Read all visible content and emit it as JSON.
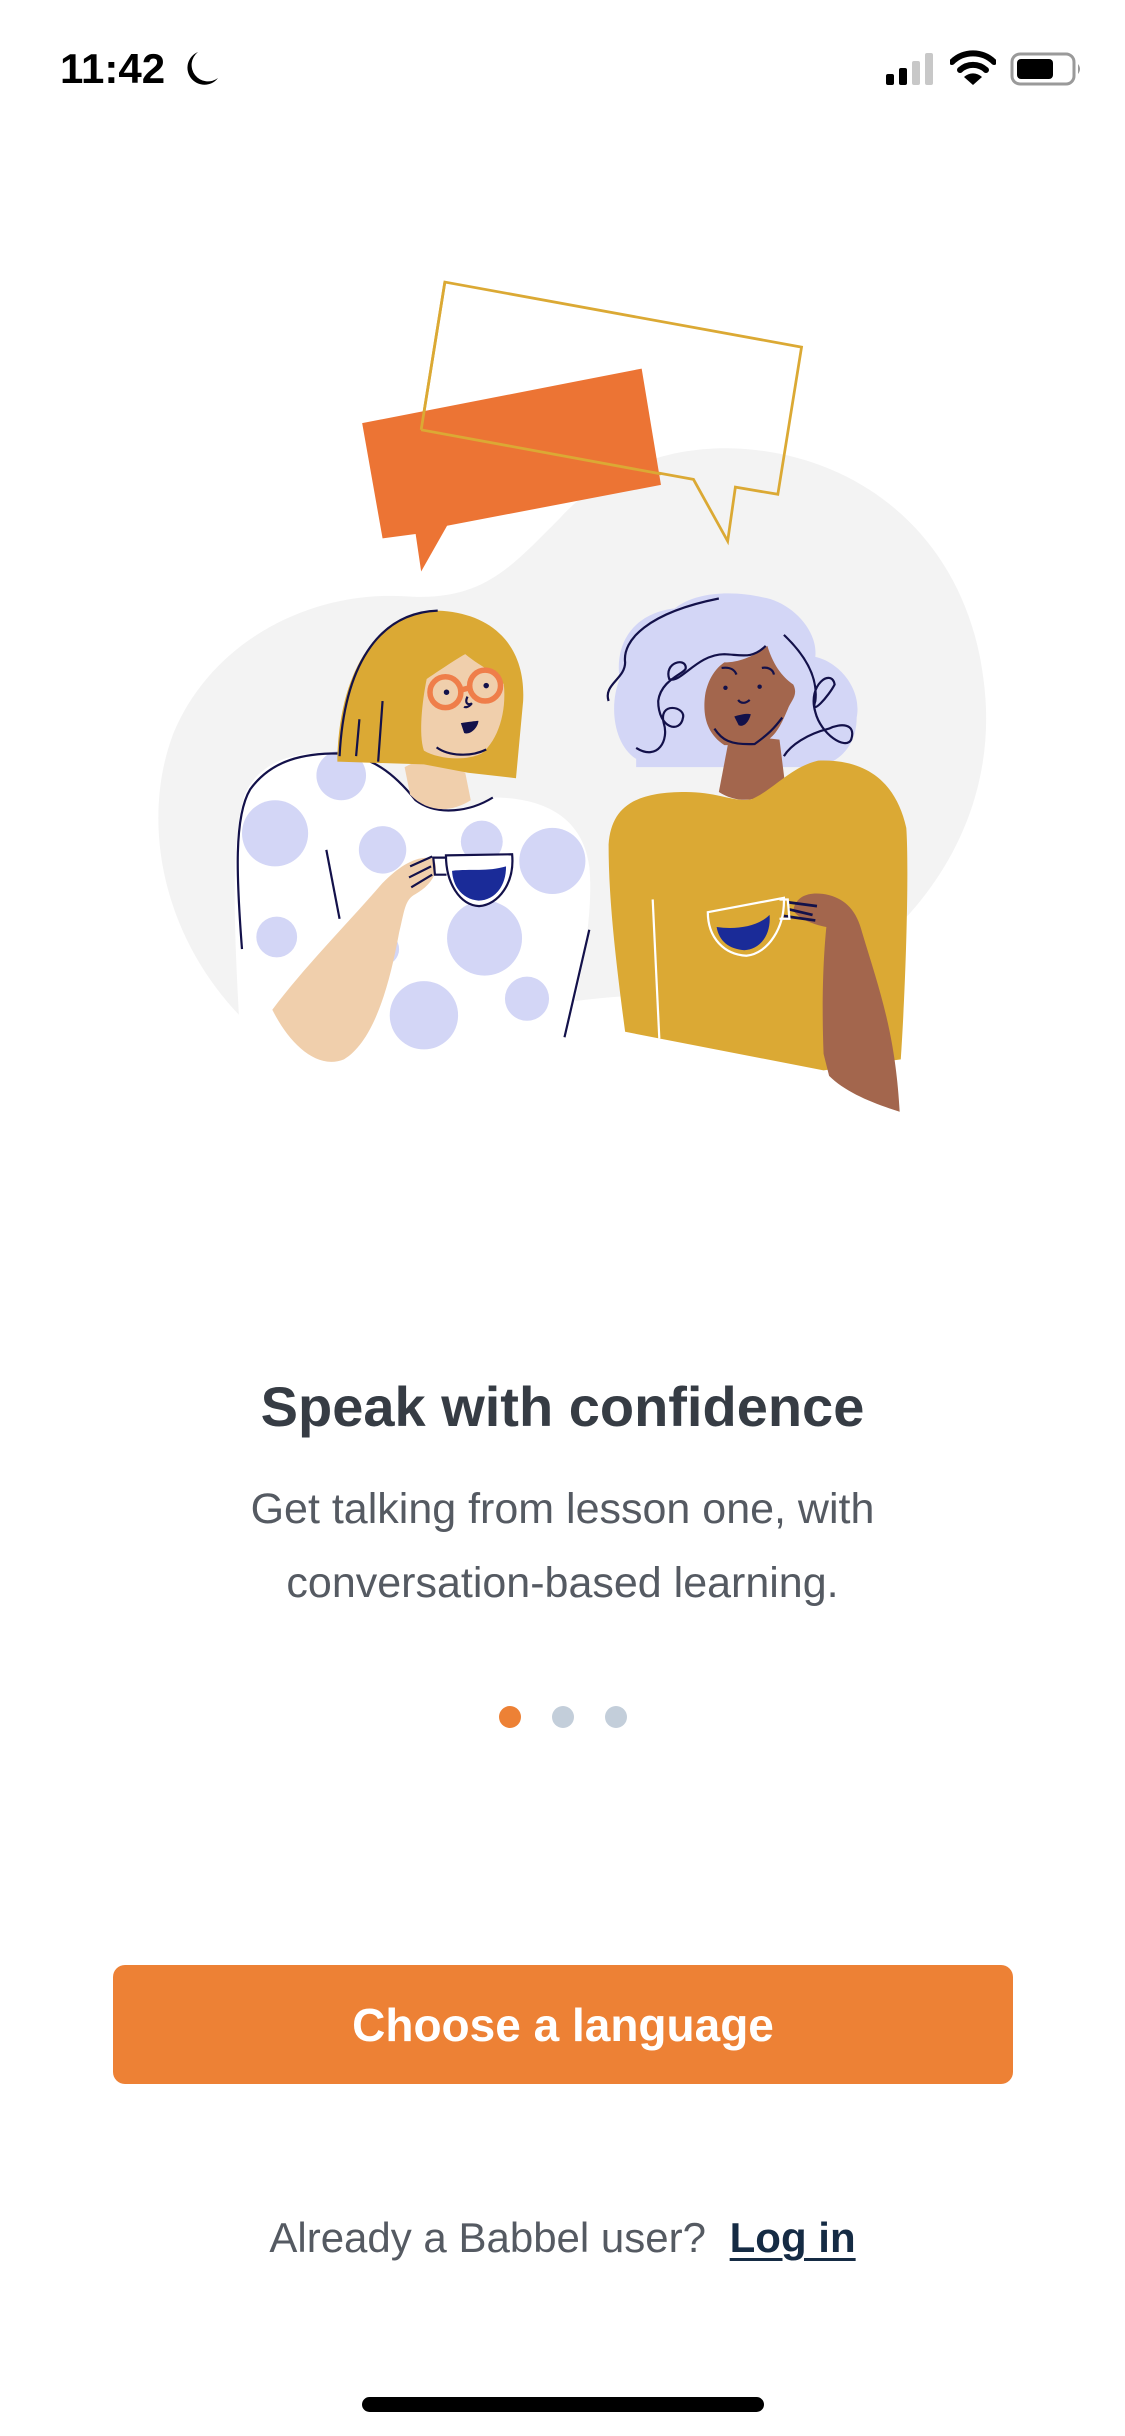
{
  "status_bar": {
    "time": "11:42",
    "focus_icon": "moon-icon",
    "signal_bars_filled": 2,
    "signal_bars_total": 4,
    "battery_level": 0.7
  },
  "illustration": {
    "description": "Two women chatting over coffee with speech bubbles",
    "colors": {
      "orange_bubble": "#ec7434",
      "bubble_outline": "#dba934",
      "background_blob": "#f3f3f3",
      "mustard": "#dbaa38",
      "lavender": "#d3d6f6",
      "light_skin": "#f0cfac",
      "dark_skin": "#a3664d",
      "coffee": "#1a2b98",
      "ink": "#13114a",
      "glasses": "#ef7e4a"
    }
  },
  "onboarding": {
    "title": "Speak with confidence",
    "subtitle": "Get talking from lesson one, with conversation-based learning.",
    "pages_total": 3,
    "current_page": 1
  },
  "cta": {
    "label": "Choose a language",
    "color": "#ed8135"
  },
  "footer": {
    "prompt": "Already a Babbel user?",
    "login_label": "Log in"
  }
}
